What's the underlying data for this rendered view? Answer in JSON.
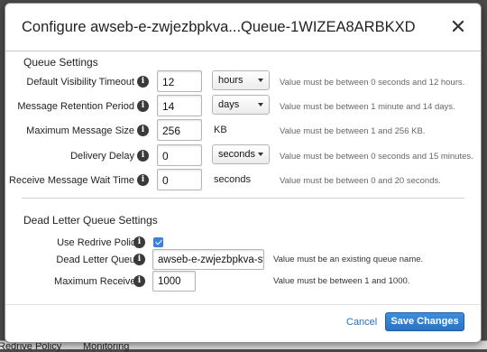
{
  "background": {
    "tabs": [
      "Redrive Policy",
      "Monitoring"
    ]
  },
  "dialog": {
    "title": "Configure awseb-e-zwjezbpkva...Queue-1WIZEA8ARBKXD",
    "close_icon": "close-icon"
  },
  "queue_settings": {
    "heading": "Queue Settings",
    "rows": [
      {
        "label": "Default Visibility Timeout",
        "value": "12",
        "unit_select": "hours",
        "hint": "Value must be between 0 seconds and 12 hours."
      },
      {
        "label": "Message Retention Period",
        "value": "14",
        "unit_select": "days",
        "hint": "Value must be between 1 minute and 14 days."
      },
      {
        "label": "Maximum Message Size",
        "value": "256",
        "unit_text": "KB",
        "hint": "Value must be between 1 and 256 KB."
      },
      {
        "label": "Delivery Delay",
        "value": "0",
        "unit_select": "seconds",
        "hint": "Value must be between 0 seconds and 15 minutes."
      },
      {
        "label": "Receive Message Wait Time",
        "value": "0",
        "unit_text": "seconds",
        "hint": "Value must be between 0 and 20 seconds."
      }
    ]
  },
  "dead_letter": {
    "heading": "Dead Letter Queue Settings",
    "use_redrive_label": "Use Redrive Policy",
    "use_redrive_checked": true,
    "queue_label": "Dead Letter Queue",
    "queue_value": "awseb-e-zwjezbpkva-st",
    "queue_hint": "Value must be an existing queue name.",
    "max_receives_label": "Maximum Receives",
    "max_receives_value": "1000",
    "max_receives_hint": "Value must be between 1 and 1000."
  },
  "footer": {
    "cancel": "Cancel",
    "save": "Save Changes"
  },
  "colors": {
    "accent": "#2a72c4",
    "info_icon": "#3a3a3a",
    "checkbox": "#3b82e0"
  }
}
